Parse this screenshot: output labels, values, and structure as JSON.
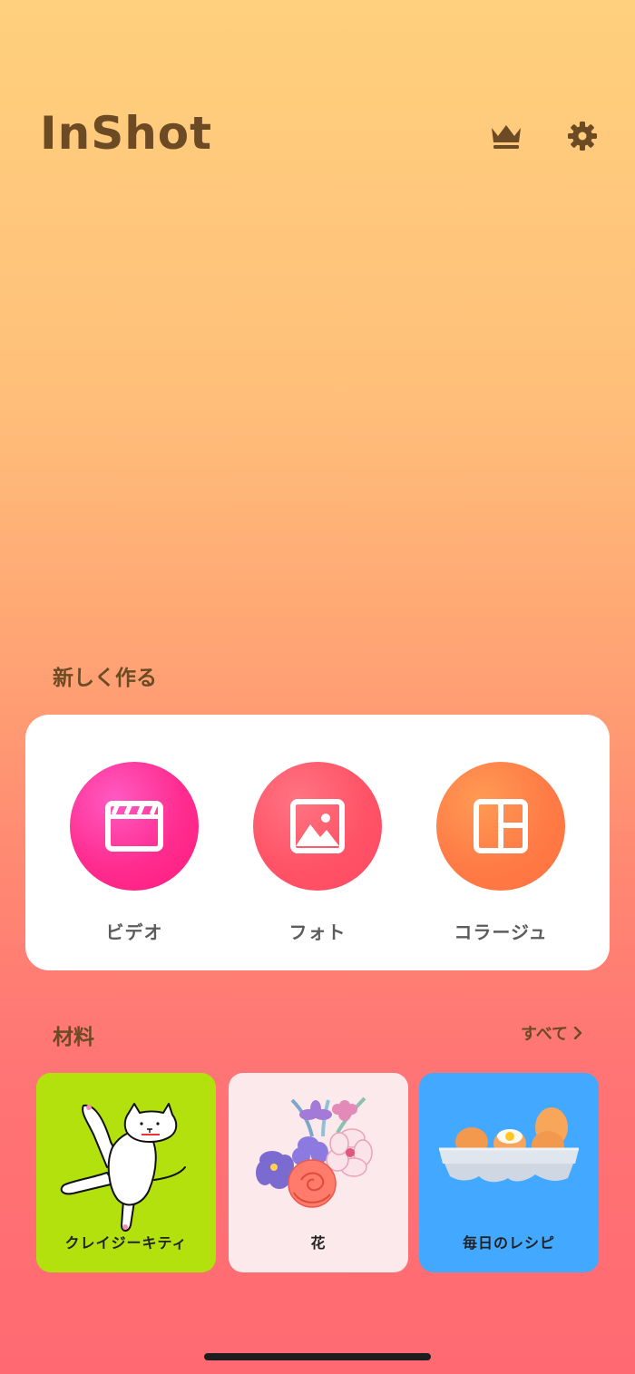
{
  "header": {
    "app_name": "InShot"
  },
  "icons": {
    "crown": "crown-icon",
    "settings": "gear-icon"
  },
  "create": {
    "title": "新しく作る",
    "items": [
      {
        "label": "ビデオ",
        "icon": "video-clapper-icon",
        "color": "#ff2c8f"
      },
      {
        "label": "フォト",
        "icon": "photo-icon",
        "color": "#ff5367"
      },
      {
        "label": "コラージュ",
        "icon": "collage-icon",
        "color": "#ff7b46"
      }
    ]
  },
  "materials": {
    "title": "材料",
    "see_all": "すべて",
    "items": [
      {
        "label": "クレイジーキティ",
        "bg": "#b3e10d"
      },
      {
        "label": "花",
        "bg": "#fbe9ec"
      },
      {
        "label": "毎日のレシピ",
        "bg": "#43a8ff"
      }
    ]
  },
  "colors": {
    "logo": "#6b4a24",
    "gradient_top": "#ffd07d",
    "gradient_bottom": "#ff6a72"
  }
}
